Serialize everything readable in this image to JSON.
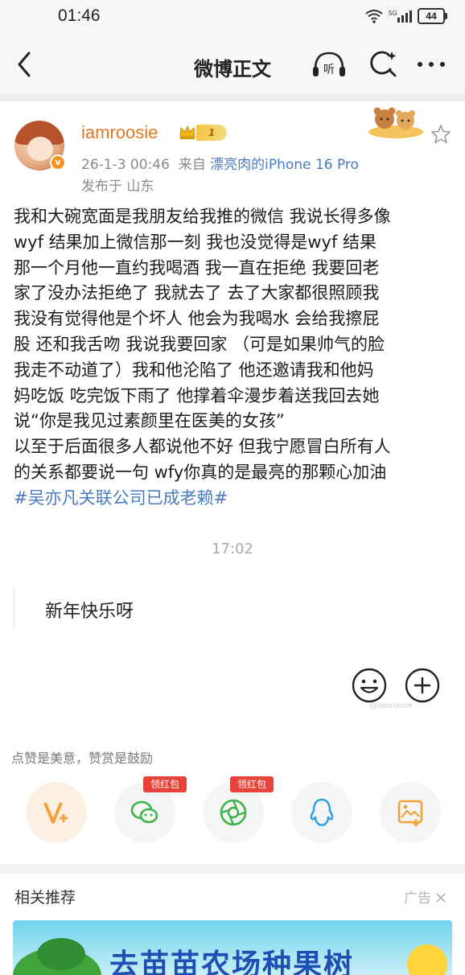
{
  "status_bar": {
    "time": "01:46",
    "network": "5G",
    "battery": "44"
  },
  "nav": {
    "title": "微博正文",
    "listen_label": "听"
  },
  "post": {
    "username": "iamroosie",
    "vip_level": "1",
    "date": "26-1-3 00:46",
    "from_label": "来自",
    "source": "漂亮肉的iPhone 16 Pro",
    "location": "发布于 山东",
    "body_lines": [
      "我和大碗宽面是我朋友给我推的微信 我说长得多像",
      "wyf 结果加上微信那一刻 我也没觉得是wyf 结果",
      "那一个月他一直约我喝酒 我一直在拒绝 我要回老",
      "家了没办法拒绝了 我就去了 去了大家都很照顾我",
      "我没有觉得他是个坏人 他会为我喝水 会给我擦屁",
      "股 还和我舌吻 我说我要回家 （可是如果帅气的脸",
      "我走不动道了）我和他沦陷了 他还邀请我和他妈",
      "妈吃饭 吃完饭下雨了 他撑着伞漫步着送我回去她",
      "说“你是我见过素颜里在医美的女孩”",
      "以至于后面很多人都说他不好 但我宁愿冒白所有人",
      "的关系都要说一句 wfy你真的是最亮的那颗心加油"
    ],
    "hashtag": "#吴亦凡关联公司已成老赖#",
    "time": "17:02"
  },
  "comment": {
    "text": "新年快乐呀"
  },
  "watermark": "@iamroosie",
  "tip": "点赞是美意，赞赏是鼓励",
  "share": {
    "red_tag_label": "领红包",
    "buttons": [
      "reward-icon",
      "wechat-icon",
      "moments-icon",
      "qq-icon",
      "save-image-icon"
    ]
  },
  "related": {
    "title": "相关推荐",
    "ad_label": "广告",
    "ad_banner_text": "去苗苗农场种果树"
  },
  "colors": {
    "username": "#e0781e",
    "link": "#4a7bc0",
    "red_tag": "#e8433b"
  }
}
